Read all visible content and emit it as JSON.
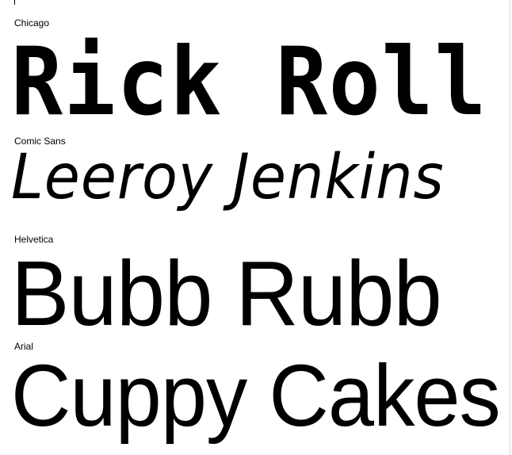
{
  "fonts": [
    {
      "label": "Chicago",
      "sample": "Rick Roll"
    },
    {
      "label": "Comic Sans",
      "sample": "Leeroy Jenkins"
    },
    {
      "label": "Helvetica",
      "sample": "Bubb Rubb"
    },
    {
      "label": "Arial",
      "sample": "Cuppy Cakes"
    }
  ]
}
